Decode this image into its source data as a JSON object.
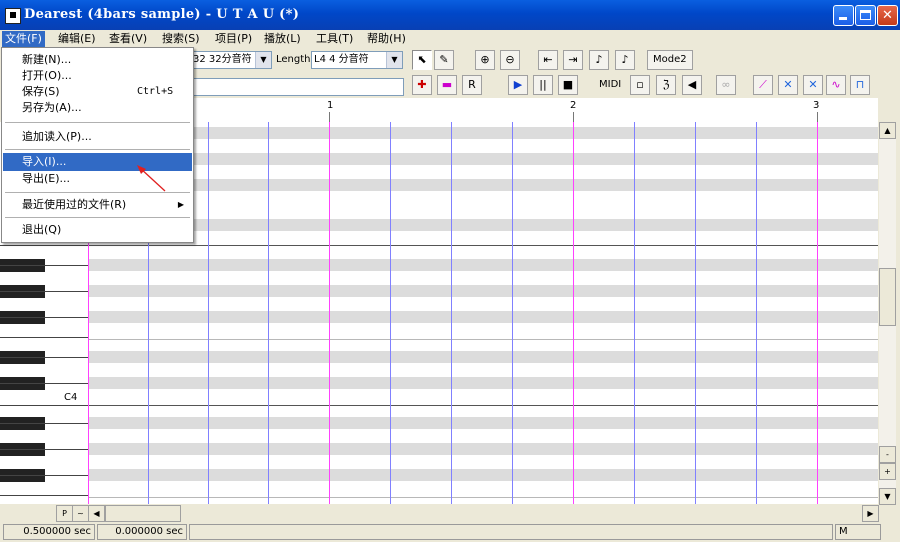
{
  "window": {
    "title": "Dearest  (4bars sample) - U T A U  (*)",
    "min_glyph": "_",
    "close_glyph": "✕"
  },
  "menubar": [
    {
      "label": "文件(F)",
      "name": "menu-file"
    },
    {
      "label": "编辑(E)",
      "name": "menu-edit"
    },
    {
      "label": "查看(V)",
      "name": "menu-view"
    },
    {
      "label": "搜索(S)",
      "name": "menu-search"
    },
    {
      "label": "项目(P)",
      "name": "menu-project"
    },
    {
      "label": "播放(L)",
      "name": "menu-play"
    },
    {
      "label": "工具(T)",
      "name": "menu-tools"
    },
    {
      "label": "帮助(H)",
      "name": "menu-help"
    }
  ],
  "file_menu": {
    "new": "新建(N)...",
    "open": "打开(O)...",
    "save": "保存(S)",
    "save_shortcut": "Ctrl+S",
    "save_as": "另存为(A)...",
    "append": "追加读入(P)...",
    "import": "导入(I)...",
    "export": "导出(E)...",
    "recent": "最近使用过的文件(R)",
    "recent_arrow": "▶",
    "exit": "退出(Q)"
  },
  "toolbar": {
    "quantize_value": "32 32分音符",
    "length_label": "Length",
    "length_value": "L4  4 分音符",
    "combo_arrow": "▼",
    "mode2": "Mode2",
    "midi": "MIDI"
  },
  "toolbar_icons": {
    "cursor": "⬉",
    "pencil": "✎",
    "zoom_in": "⊕",
    "zoom_out": "⊖",
    "to_start": "⇤",
    "to_end": "⇥",
    "play": "▶",
    "pause": "⏸",
    "stop": "■",
    "speaker": "◀",
    "sync": "∞"
  },
  "ruler": {
    "marks": [
      "1",
      "2",
      "3"
    ]
  },
  "piano": {
    "c4_label": "C4"
  },
  "scroll": {
    "up": "▲",
    "down": "▼",
    "left": "◀",
    "right": "▶",
    "minus": "-",
    "plus": "+"
  },
  "hbar": {
    "p_button": "P",
    "tilde_button": "~"
  },
  "status": {
    "field1": "0.500000 sec",
    "field2": "0.000000 sec",
    "field3": "M"
  }
}
